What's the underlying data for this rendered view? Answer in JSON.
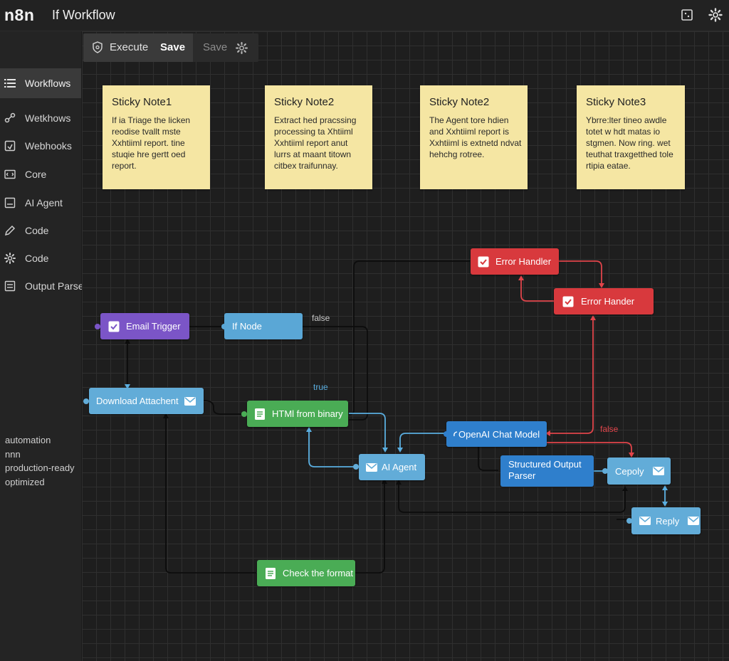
{
  "app": {
    "logo": "n8n",
    "workflow_title": "If Workflow"
  },
  "toolbar": {
    "execute_label": "Execute",
    "save_label": "Save",
    "save_secondary_label": "Save"
  },
  "sidebar": {
    "items": [
      {
        "label": "Workflows",
        "icon": "list-icon"
      },
      {
        "label": "Wetkhows",
        "icon": "share-icon"
      },
      {
        "label": "Webhooks",
        "icon": "webhook-icon"
      },
      {
        "label": "Core",
        "icon": "core-icon"
      },
      {
        "label": "AI Agent",
        "icon": "agent-icon"
      },
      {
        "label": "Code",
        "icon": "pencil-icon"
      },
      {
        "label": "Code",
        "icon": "gear-icon"
      },
      {
        "label": "Output Parser",
        "icon": "parser-icon"
      }
    ],
    "tags": [
      "automation",
      "nnn",
      "production-ready",
      "optimized"
    ]
  },
  "stickies": [
    {
      "title": "Sticky Note1",
      "body": "If ia Triage the licken reodise tvallt mste Xxhtiiml report. tine stuqie hre gertt oed report."
    },
    {
      "title": "Sticky Note2",
      "body": "Extract hed pracssing processing ta Xhtiiml Xxhtiiml report anut lurrs at maant titown citbex traifunnay."
    },
    {
      "title": "Sticky Note2",
      "body": "The Agent tore hdien and Xxhtiiml report is Xxhtiiml is extnetd ndvat hehchg rotree."
    },
    {
      "title": "Sticky Note3",
      "body": "Ybrre:lter tineo awdle totet w hdt matas io stgmen. Now ring. wet teuthat traxgetthed tole rtipia eatae."
    }
  ],
  "nodes": {
    "email_trigger": "Email Trigger",
    "if_node": "If Node",
    "download_attachment": "Download Attachent",
    "html_from_binary": "HTMl from binary",
    "ai_agent": "AI Agent",
    "check_format": "Check the format",
    "error_handler_1": "Error Handler",
    "error_handler_2": "Error Hander",
    "openai_chat_model": "OpenAI Chat Model",
    "structured_output_parser": "Structured Output Parser",
    "cepoly": "Cepoly",
    "reply": "Reply"
  },
  "edge_labels": {
    "false_top": "false",
    "true": "true",
    "false_right": "false"
  },
  "colors": {
    "trigger": "#7b55c7",
    "action": "#5aa7d6",
    "transform": "#4aac55",
    "error": "#d8393d",
    "model": "#2f7fcc",
    "sticky": "#f5e6a3",
    "wire_blue": "#5aaee0",
    "wire_red": "#e0444a",
    "wire_black": "#0c0c0c"
  }
}
